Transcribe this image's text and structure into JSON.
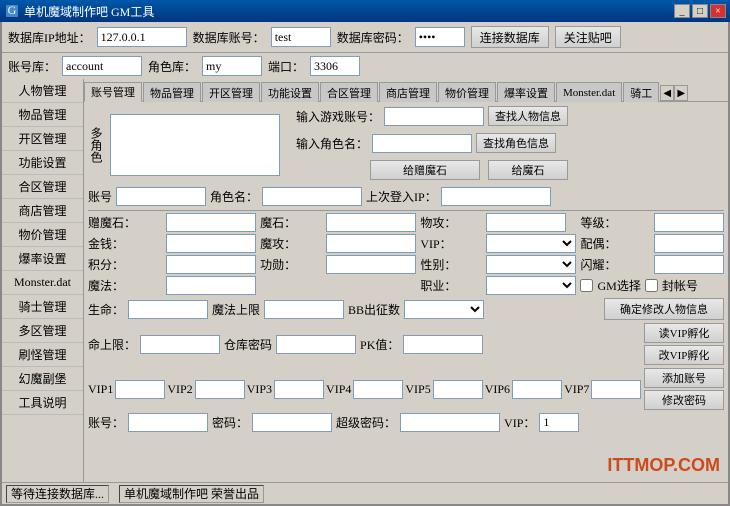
{
  "titleBar": {
    "icon": "⚙",
    "title": "单机魔域制作吧 GM工具",
    "minimizeLabel": "_",
    "maximizeLabel": "□",
    "closeLabel": "×"
  },
  "configBar": {
    "dbIpLabel": "数据库IP地址：",
    "dbIpValue": "127.0.0.1",
    "dbAccountLabel": "数据库账号：",
    "dbAccountValue": "test",
    "dbPasswordLabel": "数据库密码：",
    "dbPasswordValue": "****",
    "connectBtnLabel": "连接数据库",
    "closeBtnLabel": "关注贴吧"
  },
  "accountBar": {
    "accountLabel": "账号库：",
    "accountValue": "account",
    "roleLabel": "角色库：",
    "roleValue": "my",
    "portLabel": "端口：",
    "portValue": "3306"
  },
  "sidebar": {
    "items": [
      {
        "label": "人物管理",
        "active": false
      },
      {
        "label": "物品管理",
        "active": false
      },
      {
        "label": "开区管理",
        "active": false
      },
      {
        "label": "功能设置",
        "active": false
      },
      {
        "label": "合区管理",
        "active": false
      },
      {
        "label": "商店管理",
        "active": false
      },
      {
        "label": "物价管理",
        "active": false
      },
      {
        "label": "爆率设置",
        "active": false
      },
      {
        "label": "Monster.dat",
        "active": false
      },
      {
        "label": "骑士管理",
        "active": false
      },
      {
        "label": "多区管理",
        "active": false
      },
      {
        "label": "刷怪管理",
        "active": false
      },
      {
        "label": "幻魔副堡",
        "active": false
      },
      {
        "label": "工具说明",
        "active": false
      }
    ]
  },
  "tabs": {
    "items": [
      {
        "label": "账号管理",
        "active": true
      },
      {
        "label": "物品管理",
        "active": false
      },
      {
        "label": "开区管理",
        "active": false
      },
      {
        "label": "功能设置",
        "active": false
      },
      {
        "label": "合区管理",
        "active": false
      },
      {
        "label": "商店管理",
        "active": false
      },
      {
        "label": "物价管理",
        "active": false
      },
      {
        "label": "爆率设置",
        "active": false
      },
      {
        "label": "Monster.dat",
        "active": false
      },
      {
        "label": "骑工",
        "active": false
      }
    ]
  },
  "accountPanel": {
    "multiCharLabel": "多角色",
    "searchAccountLabel": "输入游戏账号：",
    "searchRoleLabel": "输入角色名：",
    "searchAccountBtnLabel": "查找人物信息",
    "searchRoleBtnLabel": "查找角色信息",
    "giveMagicStoneBtnLabel": "给赠魔石",
    "giveMagicBtnLabel": "给魔石",
    "accountLabel": "账号",
    "roleNameLabel": "角色名：",
    "lastLoginIPLabel": "上次登入IP：",
    "donatedMagicLabel": "赠魔石：",
    "magicLabel": "魔石：",
    "physAttackLabel": "物攻：",
    "levelLabel": "等级：",
    "goldLabel": "金钱：",
    "magicAttackLabel": "魔攻：",
    "vipLabel": "VIP：",
    "spouseLabel": "配偶：",
    "pointsLabel": "积分：",
    "meritLabel": "功勋：",
    "genderLabel": "性别：",
    "flawlessLabel": "闪耀：",
    "magicLabel2": "魔法：",
    "jobLabel": "职业：",
    "gmSelectLabel": "GM选择",
    "sealAccountLabel": "封帐号",
    "lifeLabel": "生命：",
    "magicUpperLabel": "魔法上限",
    "bbExitLabel": "BB出征数",
    "upperLimitLabel": "命上限：",
    "warehousePwdLabel": "仓库密码",
    "pkValueLabel": "PK值：",
    "confirmBtnLabel": "确定修改人物信息",
    "readVipBtnLabel": "读VIP孵化",
    "modifyVipBtnLabel": "改VIP孵化",
    "addAccountBtnLabel": "添加账号",
    "modifyPasswordBtnLabel": "修改密码",
    "vipLabels": [
      "VIP1",
      "VIP2",
      "VIP3",
      "VIP4",
      "VIP5",
      "VIP6",
      "VIP7"
    ],
    "accountLabel2": "账号：",
    "passwordLabel": "密码：",
    "superPasswordLabel": "超级密码：",
    "vipLabel2": "VIP：",
    "vipValue": "1"
  },
  "statusBar": {
    "waitingText": "等待连接数据库...",
    "copyrightText": "单机魔域制作吧 荣誉出品"
  },
  "watermark": "ITTMOP.COM"
}
